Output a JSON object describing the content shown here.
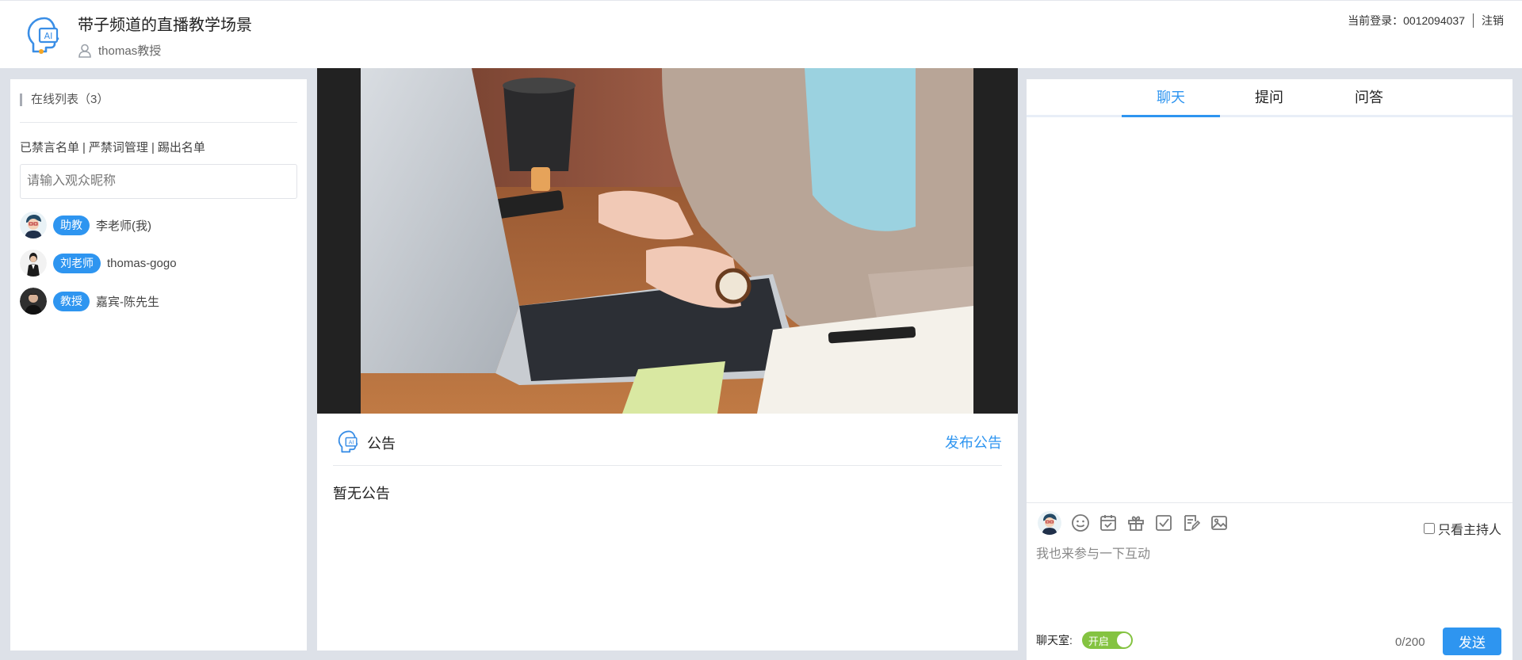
{
  "header": {
    "room_title": "带子频道的直播教学场景",
    "host_name": "thomas教授",
    "login_label": "当前登录：0012094037",
    "logout_label": "注销",
    "logo_icon": "ai-head-logo-icon",
    "user_icon": "user-outline-icon"
  },
  "online": {
    "title": "在线列表（3）",
    "links": [
      "已禁言名单",
      "严禁词管理",
      "踢出名单"
    ],
    "search_placeholder": "请输入观众昵称",
    "users": [
      {
        "role": "助教",
        "name": "李老师(我)"
      },
      {
        "role": "刘老师",
        "name": "thomas-gogo"
      },
      {
        "role": "教授",
        "name": "嘉宾-陈先生"
      }
    ]
  },
  "notice": {
    "title": "公告",
    "publish_label": "发布公告",
    "empty_text": "暂无公告"
  },
  "chat": {
    "tabs": [
      "聊天",
      "提问",
      "问答"
    ],
    "active_tab": 0,
    "toolbar_icons": [
      "emoji-icon",
      "calendar-icon",
      "gift-icon",
      "checkin-icon",
      "edit-note-icon",
      "image-icon"
    ],
    "host_only_label": "只看主持人",
    "input_placeholder": "我也来参与一下互动",
    "chatroom_label": "聊天室:",
    "toggle_label": "开启",
    "toggle_on": true,
    "char_count": "0/200",
    "send_label": "发送"
  },
  "colors": {
    "accent": "#2e95f0",
    "toggle_green": "#84c341",
    "background": "#dde1e8"
  }
}
